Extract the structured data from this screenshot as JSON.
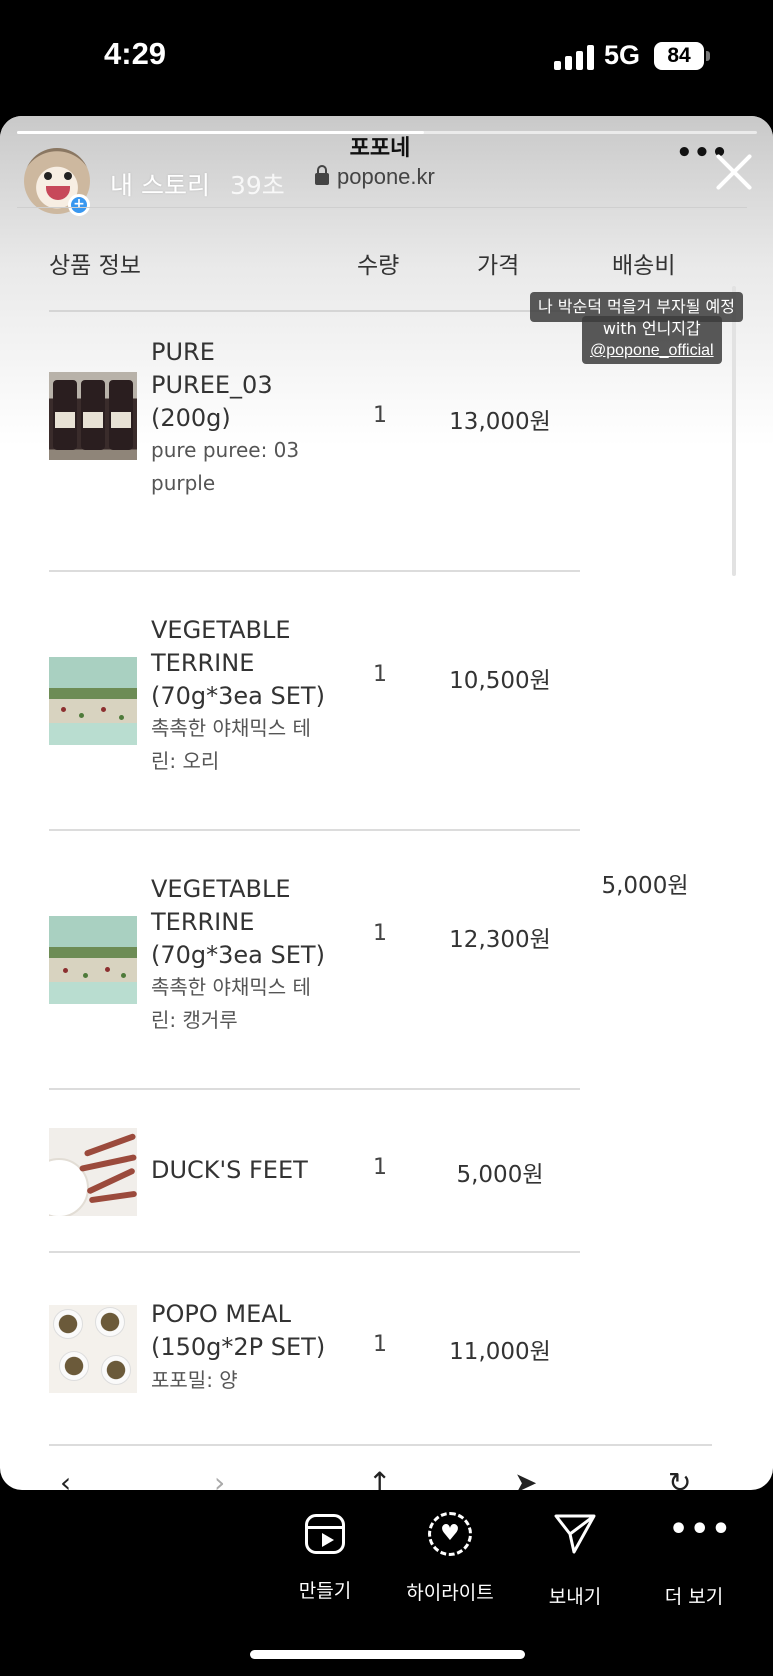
{
  "status_bar": {
    "time": "4:29",
    "network": "5G",
    "battery": "84"
  },
  "story": {
    "user": "내 스토리",
    "time_ago": "39초",
    "progress": 0.55,
    "avatar_icon": "dog-avatar-icon"
  },
  "browser": {
    "title": "포포네",
    "url": "popone.kr",
    "more_icon": "more-horizontal-icon",
    "close_icon": "close-icon"
  },
  "table": {
    "headers": {
      "product": "상품 정보",
      "qty": "수량",
      "price": "가격",
      "shipping": "배송비"
    },
    "shipping_fee": "5,000원",
    "rows": [
      {
        "name_lines": [
          "PURE",
          "PUREE_03",
          "(200g)"
        ],
        "option_lines": [
          "pure puree: 03",
          "purple"
        ],
        "qty": "1",
        "price": "13,000원"
      },
      {
        "name_lines": [
          "VEGETABLE",
          "TERRINE",
          "(70g*3ea SET)"
        ],
        "option_lines": [
          "촉촉한 야채믹스 테",
          "린: 오리"
        ],
        "qty": "1",
        "price": "10,500원"
      },
      {
        "name_lines": [
          "VEGETABLE",
          "TERRINE",
          "(70g*3ea SET)"
        ],
        "option_lines": [
          "촉촉한 야채믹스 테",
          "린: 캥거루"
        ],
        "qty": "1",
        "price": "12,300원"
      },
      {
        "name_lines": [
          "DUCK'S FEET"
        ],
        "option_lines": [],
        "qty": "1",
        "price": "5,000원"
      },
      {
        "name_lines": [
          "POPO MEAL",
          "(150g*2P SET)"
        ],
        "option_lines": [
          "포포밀: 양"
        ],
        "qty": "1",
        "price": "11,000원"
      }
    ]
  },
  "sticker": {
    "line1": "나 박순덕 먹을거 부자될 예정",
    "line2": "with 언니지갑",
    "handle": "@popone_official"
  },
  "bottom_bar": {
    "actions": [
      {
        "label": "만들기",
        "icon": "reels-icon"
      },
      {
        "label": "하이라이트",
        "icon": "highlight-icon"
      },
      {
        "label": "보내기",
        "icon": "send-icon"
      },
      {
        "label": "더 보기",
        "icon": "more-icon"
      }
    ]
  },
  "colors": {
    "accent_blue": "#3897f0",
    "background": "#000000",
    "card": "#ffffff"
  }
}
